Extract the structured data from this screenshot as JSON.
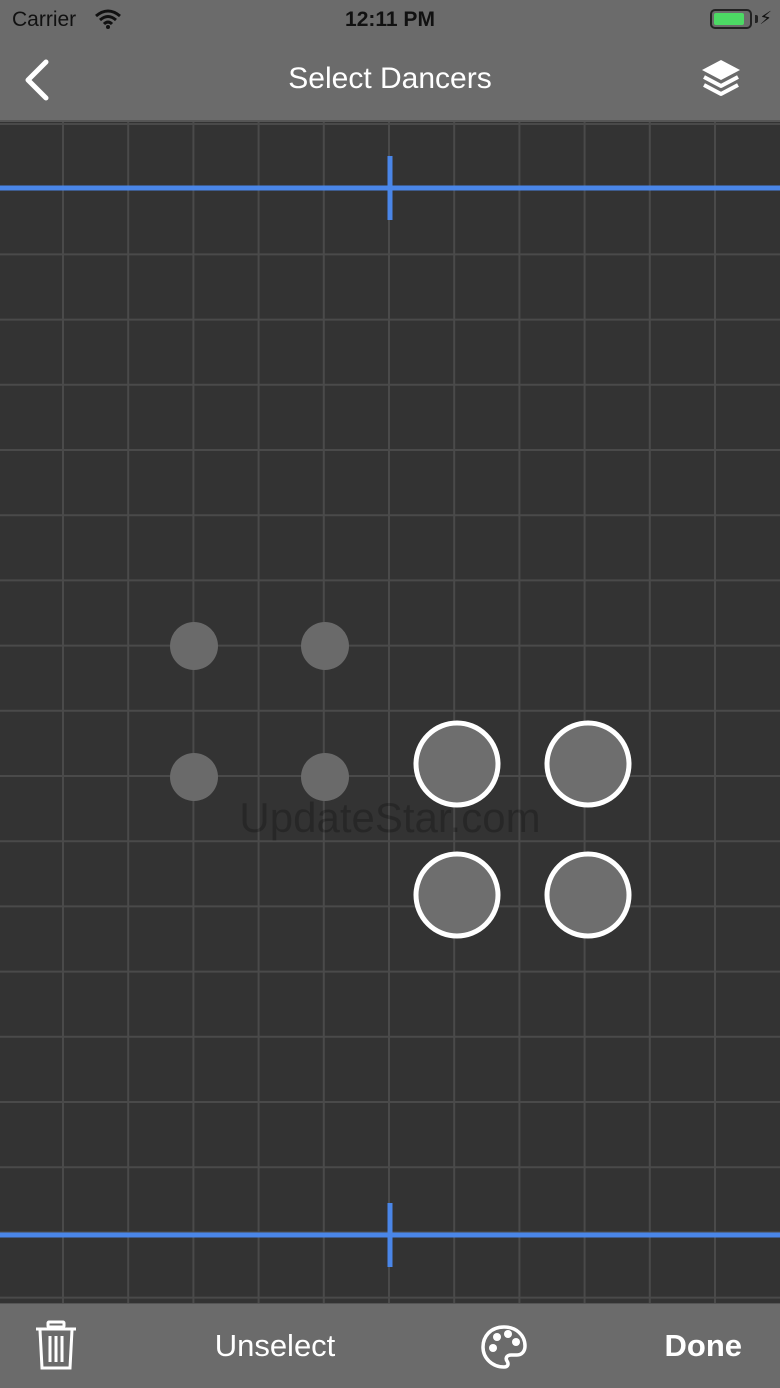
{
  "status_bar": {
    "carrier": "Carrier",
    "time": "12:11 PM",
    "battery_color": "#4cd964"
  },
  "nav": {
    "back_icon": "chevron-left-icon",
    "title": "Select Dancers",
    "layers_icon": "layers-icon"
  },
  "stage": {
    "background": "#333333",
    "grid_color": "#4a4a4a",
    "marker_line_color": "#4a86e8",
    "watermark": "UpdateStar.com",
    "dancers": [
      {
        "selected": false
      },
      {
        "selected": false
      },
      {
        "selected": false
      },
      {
        "selected": false
      },
      {
        "selected": true
      },
      {
        "selected": true
      },
      {
        "selected": true
      },
      {
        "selected": true
      }
    ]
  },
  "toolbar": {
    "trash_icon": "trash-icon",
    "unselect_label": "Unselect",
    "palette_icon": "palette-icon",
    "done_label": "Done"
  }
}
